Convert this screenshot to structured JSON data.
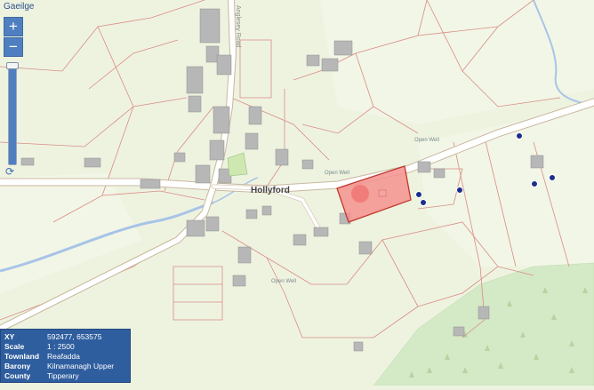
{
  "language_link": "Gaeilge",
  "zoom": {
    "in_label": "+",
    "out_label": "−",
    "refresh_glyph": "⟳",
    "level_fraction": 0.97
  },
  "map": {
    "place_name": "Hollyford",
    "road_label": "Anglesey Road",
    "open_well_labels": [
      "Open Well",
      "Open Well",
      "Open Well"
    ],
    "colors": {
      "background": "#eef3e0",
      "field_boundary": "#d98c85",
      "road": "#ffffff",
      "river": "#a7c4e8",
      "building": "#b7b7b7",
      "forest": "#cfe6c0",
      "highlight_fill": "#f4908e",
      "marker": "#1c2e8c"
    },
    "icons": [
      "tree-icon",
      "marker-icon"
    ]
  },
  "info_panel": {
    "rows": [
      {
        "key": "XY",
        "value": "592477, 653575"
      },
      {
        "key": "Scale",
        "value": "1 : 2500"
      },
      {
        "key": "Townland",
        "value": "Reafadda"
      },
      {
        "key": "Barony",
        "value": "Kilnamanagh Upper"
      },
      {
        "key": "County",
        "value": "Tipperary"
      }
    ]
  }
}
